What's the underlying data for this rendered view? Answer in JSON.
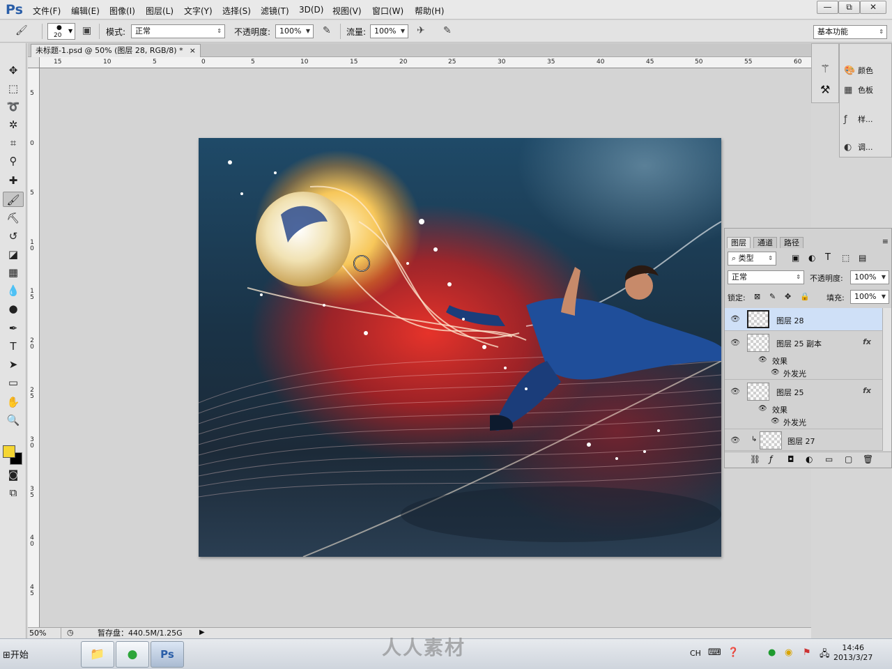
{
  "app": {
    "logo": "Ps"
  },
  "menu": [
    "文件(F)",
    "编辑(E)",
    "图像(I)",
    "图层(L)",
    "文字(Y)",
    "选择(S)",
    "滤镜(T)",
    "3D(D)",
    "视图(V)",
    "窗口(W)",
    "帮助(H)"
  ],
  "window_controls": {
    "minimize": "—",
    "restore": "⧉",
    "close": "✕"
  },
  "options": {
    "brush_size": "20",
    "mode_label": "模式:",
    "mode_value": "正常",
    "opacity_label": "不透明度:",
    "opacity_value": "100%",
    "flow_label": "流量:",
    "flow_value": "100%",
    "workspace": "基本功能"
  },
  "document": {
    "tab_title": "未标题-1.psd @ 50% (图层 28, RGB/8) *",
    "tab_close": "×",
    "zoom": "50%",
    "scratch": "暂存盘：440.5M/1.25G"
  },
  "rulers": {
    "h": [
      "15",
      "10",
      "5",
      "0",
      "5",
      "10",
      "15",
      "20",
      "25",
      "30",
      "35",
      "40",
      "45",
      "50",
      "55",
      "60"
    ],
    "v": [
      "5",
      "0",
      "5",
      "1 0",
      "1 5",
      "2 0",
      "2 5",
      "3 0",
      "3 5",
      "4 0",
      "4 5"
    ]
  },
  "mini_panels": {
    "color": "颜色",
    "swatches": "色板",
    "styles": "样...",
    "adjustments": "调..."
  },
  "layers_panel": {
    "tabs": [
      "图层",
      "通道",
      "路径"
    ],
    "kind_filter": "类型",
    "blend_mode": "正常",
    "opacity_label": "不透明度:",
    "opacity_value": "100%",
    "lock_label": "锁定:",
    "fill_label": "填充:",
    "fill_value": "100%",
    "layers": [
      {
        "name": "图层 28",
        "selected": true
      },
      {
        "name": "图层 25 副本",
        "fx": "fx",
        "effects_label": "效果",
        "effect": "外发光"
      },
      {
        "name": "图层 25",
        "fx": "fx",
        "effects_label": "效果",
        "effect": "外发光"
      },
      {
        "name": "图层 27"
      }
    ]
  },
  "taskbar": {
    "start": "开始",
    "lang": "CH",
    "time": "14:46",
    "date": "2013/3/27"
  },
  "watermark": "人人素材"
}
